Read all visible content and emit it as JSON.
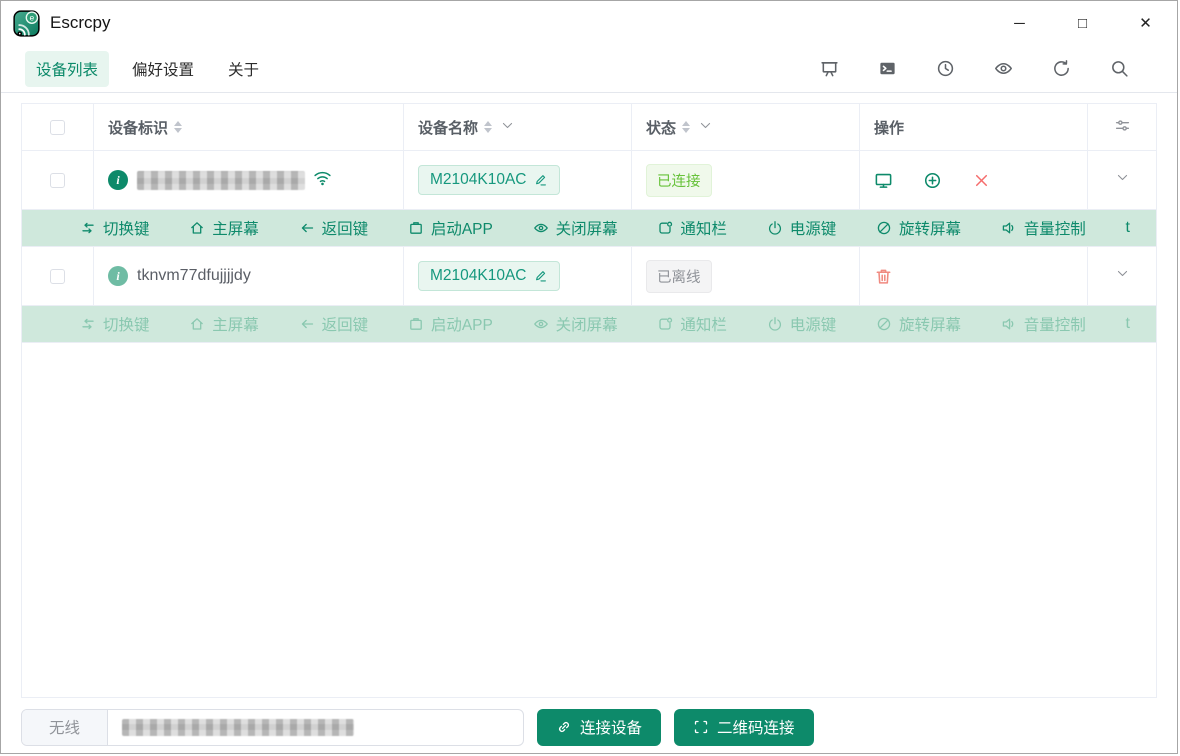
{
  "window": {
    "title": "Escrcpy",
    "controls": {
      "minimize": "─",
      "maximize": "□",
      "close": "✕"
    }
  },
  "tabs": {
    "items": [
      {
        "label": "设备列表",
        "active": true
      },
      {
        "label": "偏好设置",
        "active": false
      },
      {
        "label": "关于",
        "active": false
      }
    ]
  },
  "toolbar": {
    "icons": [
      "screen-mirror",
      "terminal",
      "history",
      "preview",
      "refresh",
      "search"
    ]
  },
  "table": {
    "columns": {
      "device_id": "设备标识",
      "device_name": "设备名称",
      "status": "状态",
      "operation": "操作"
    },
    "rows": [
      {
        "device_id": "",
        "device_id_redacted": true,
        "wireless": true,
        "device_name": "M2104K10AC",
        "status": "已连接",
        "status_type": "success",
        "operations": [
          "mirror",
          "add",
          "close"
        ],
        "actions_enabled": true
      },
      {
        "device_id": "tknvm77dfujjjjdy",
        "device_id_redacted": false,
        "wireless": false,
        "device_name": "M2104K10AC",
        "status": "已离线",
        "status_type": "info",
        "operations": [
          "delete"
        ],
        "actions_enabled": false
      }
    ],
    "action_bar": {
      "items": [
        "切换键",
        "主屏幕",
        "返回键",
        "启动APP",
        "关闭屏幕",
        "通知栏",
        "电源键",
        "旋转屏幕",
        "音量控制"
      ],
      "overflow": "t"
    }
  },
  "footer": {
    "mode": "无线",
    "address_redacted": true,
    "connect": "连接设备",
    "qr_connect": "二维码连接"
  },
  "colors": {
    "primary": "#0d8a6a",
    "primary_light_bg": "#e7f5ef",
    "action_bar_bg": "#cfe8dc",
    "name_tag_bg": "#e9f6f0",
    "success": "#67c23a",
    "success_bg": "#f0f9eb",
    "info": "#909399",
    "info_bg": "#f4f4f5",
    "danger": "#f56c6c",
    "border": "#ebeef5"
  }
}
